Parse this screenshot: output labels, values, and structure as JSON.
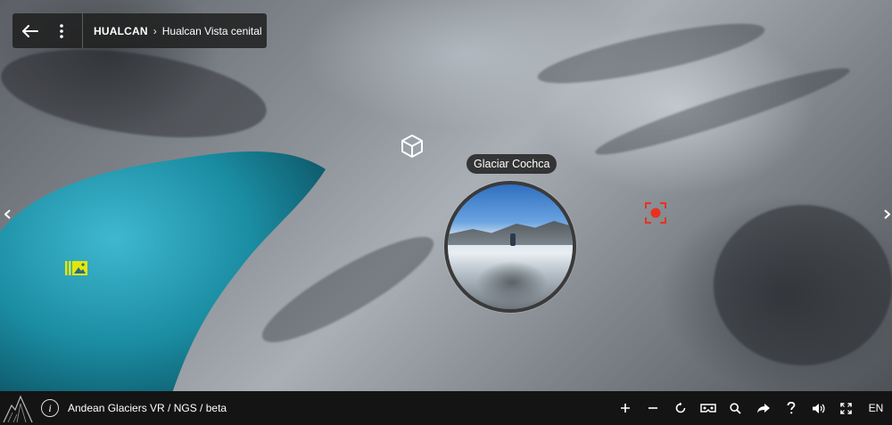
{
  "breadcrumb": {
    "root": "HUALCAN",
    "separator": "›",
    "current": "Hualcan Vista cenital"
  },
  "hotspots": {
    "portal_label": "Glaciar Cochca"
  },
  "footer": {
    "tour_title": "Andean Glaciers VR / NGS / beta",
    "info_glyph": "i",
    "language": "EN"
  },
  "icons": {
    "back": "arrow-left-icon",
    "menu": "vertical-dots-icon",
    "cube": "cube-icon",
    "gallery": "photo-gallery-icon",
    "target": "target-icon",
    "logo": "mountain-logo-icon",
    "zoom_in": "plus-icon",
    "zoom_out": "minus-icon",
    "autorotate": "rotate-icon",
    "vr": "vr-headset-icon",
    "search": "search-icon",
    "share": "share-arrow-icon",
    "help": "question-icon",
    "sound": "speaker-icon",
    "fullscreen": "fullscreen-icon"
  },
  "colors": {
    "lake": "#1b8da3",
    "target_hotspot": "#e8321e",
    "gallery_hotspot": "#e4e60b",
    "bar_bg": "#141414"
  }
}
